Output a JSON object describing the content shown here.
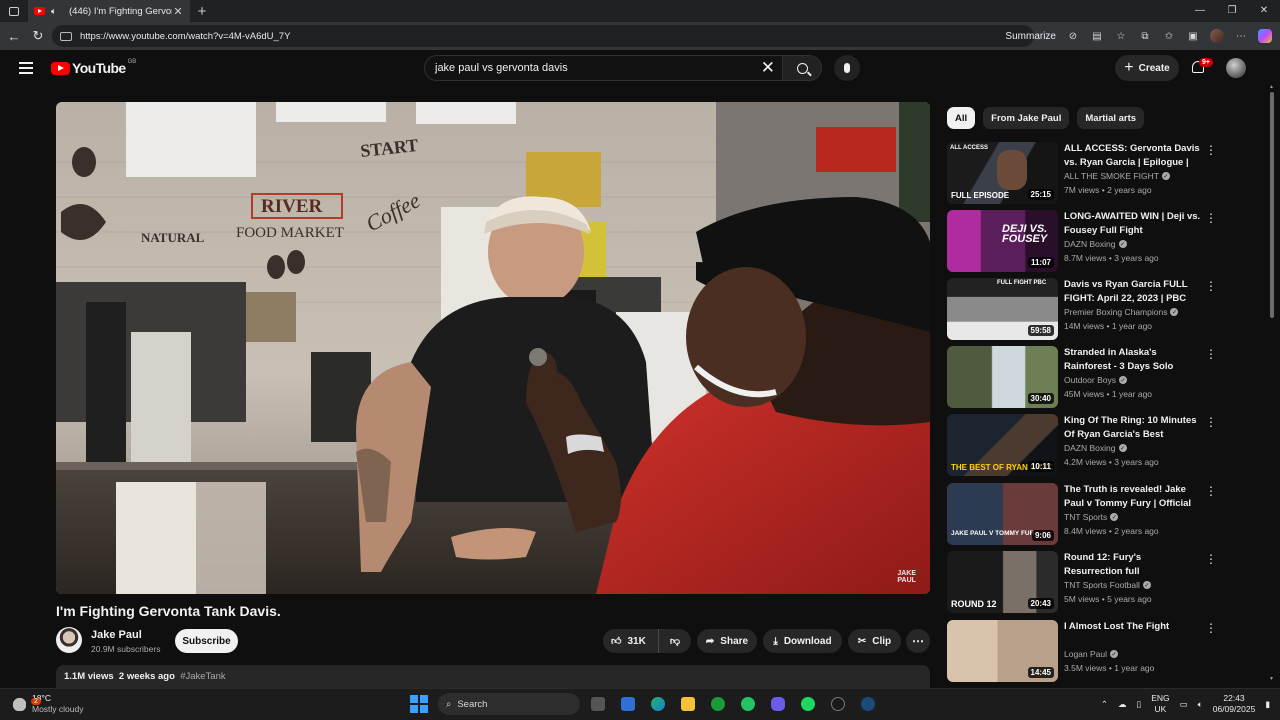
{
  "browser": {
    "tab_title": "(446) I'm Fighting Gervonta",
    "url": "https://www.youtube.com/watch?v=4M-vA6dU_7Y",
    "summarize_label": "Summarize"
  },
  "header": {
    "logo_text": "YouTube",
    "country_code": "GB",
    "search_value": "jake paul vs gervonta davis",
    "create_label": "Create",
    "notification_count": "9+"
  },
  "video": {
    "title": "I'm Fighting Gervonta Tank Davis.",
    "channel": "Jake Paul",
    "subscribers": "20.9M subscribers",
    "subscribe_label": "Subscribe",
    "likes": "31K",
    "share_label": "Share",
    "download_label": "Download",
    "clip_label": "Clip",
    "views": "1.1M views",
    "age": "2 weeks ago",
    "hashtag": "#JakeTank",
    "watermark_top": "JAKE",
    "watermark_bottom": "PAUL",
    "scene_sign_top": "RIVER",
    "scene_sign_bottom": "FOOD MARKET",
    "scene_natural": "NATURAL",
    "scene_start": "START",
    "scene_coffee": "Coffee"
  },
  "chips": [
    {
      "label": "All",
      "active": true
    },
    {
      "label": "From Jake Paul",
      "active": false
    },
    {
      "label": "Martial arts",
      "active": false
    }
  ],
  "recommendations": [
    {
      "title": "ALL ACCESS: Gervonta Davis vs. Ryan Garcia | Epilogue | Ful...",
      "channel": "ALL THE SMOKE FIGHT",
      "verified": true,
      "views": "7M views",
      "age": "2 years ago",
      "duration": "25:15",
      "thumb_text": "FULL EPISODE",
      "thumb_top": "ALL ACCESS"
    },
    {
      "title": "LONG-AWAITED WIN | Deji vs. Fousey Full Fight",
      "channel": "DAZN Boxing",
      "verified": true,
      "views": "8.7M views",
      "age": "3 years ago",
      "duration": "11:07",
      "thumb_text": "DEJI VS. FOUSEY",
      "thumb_top": ""
    },
    {
      "title": "Davis vs Ryan Garcia FULL FIGHT: April 22, 2023 | PBC on...",
      "channel": "Premier Boxing Champions",
      "verified": true,
      "views": "14M views",
      "age": "1 year ago",
      "duration": "59:58",
      "thumb_text": "",
      "thumb_top": "FULL FIGHT PBC"
    },
    {
      "title": "Stranded in Alaska's Rainforest - 3 Days Solo camping",
      "channel": "Outdoor Boys",
      "verified": true,
      "views": "45M views",
      "age": "1 year ago",
      "duration": "30:40",
      "thumb_text": "",
      "thumb_top": ""
    },
    {
      "title": "King Of The Ring: 10 Minutes Of Ryan Garcia's Best Moments",
      "channel": "DAZN Boxing",
      "verified": true,
      "views": "4.2M views",
      "age": "3 years ago",
      "duration": "10:11",
      "thumb_text": "THE BEST OF RYAN GARC",
      "thumb_top": ""
    },
    {
      "title": "The Truth is revealed! Jake Paul v Tommy Fury | Official Fight ...",
      "channel": "TNT Sports",
      "verified": true,
      "views": "8.4M views",
      "age": "2 years ago",
      "duration": "9:06",
      "thumb_text": "JAKE PAUL V TOMMY FUR",
      "thumb_top": ""
    },
    {
      "title": "Round 12: Fury's Resurrection full documentary | The final ...",
      "channel": "TNT Sports Football",
      "verified": true,
      "views": "5M views",
      "age": "5 years ago",
      "duration": "20:43",
      "thumb_text": "ROUND 12",
      "thumb_top": ""
    },
    {
      "title": "I Almost Lost The Fight",
      "channel": "Logan Paul",
      "verified": true,
      "views": "3.5M views",
      "age": "1 year ago",
      "duration": "14:45",
      "thumb_text": "",
      "thumb_top": ""
    }
  ],
  "taskbar": {
    "notification_count": "2",
    "temperature": "18°C",
    "condition": "Mostly cloudy",
    "search_label": "Search",
    "lang_top": "ENG",
    "lang_bottom": "UK",
    "time": "22:43",
    "date": "06/09/2025"
  },
  "colors": {
    "page_bg": "#0f0f0f",
    "youtube_red": "#ff0000",
    "chip_bg": "#272727",
    "secondary_text": "#aaaaaa"
  }
}
